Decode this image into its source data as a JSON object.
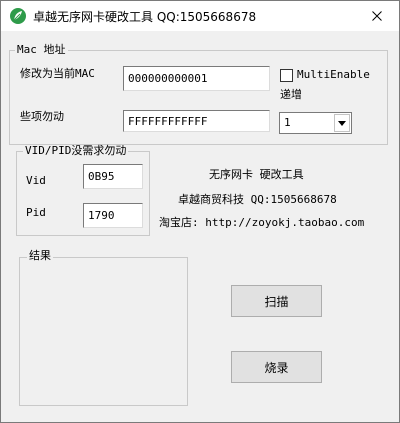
{
  "window": {
    "title": "卓越无序网卡硬改工具 QQ:1505668678",
    "close_glyph": "✕"
  },
  "mac_group": {
    "title": "Mac 地址",
    "modify_label": "修改为当前MAC",
    "mac_value": "000000000001",
    "multi_enable_label": "MultiEnable",
    "increment_label": "递增",
    "some_label": "些项勿动",
    "mask_value": "FFFFFFFFFFFF",
    "increment_step": "1"
  },
  "vid_pid_group": {
    "title": "VID/PID没需求勿动",
    "vid_label": "Vid",
    "vid_value": "0B95",
    "pid_label": "Pid",
    "pid_value": "1790"
  },
  "info": {
    "line1": "无序网卡 硬改工具",
    "line2": "卓越商贸科技 QQ:1505668678",
    "line3": "淘宝店: http://zoyokj.taobao.com"
  },
  "result_group": {
    "title": "结果"
  },
  "buttons": {
    "scan": "扫描",
    "burn": "烧录"
  },
  "colors": {
    "window_bg": "#f0f0f0",
    "titlebar_bg": "#ffffff",
    "button_bg": "#e1e1e1",
    "icon_green": "#2e9b4a"
  }
}
